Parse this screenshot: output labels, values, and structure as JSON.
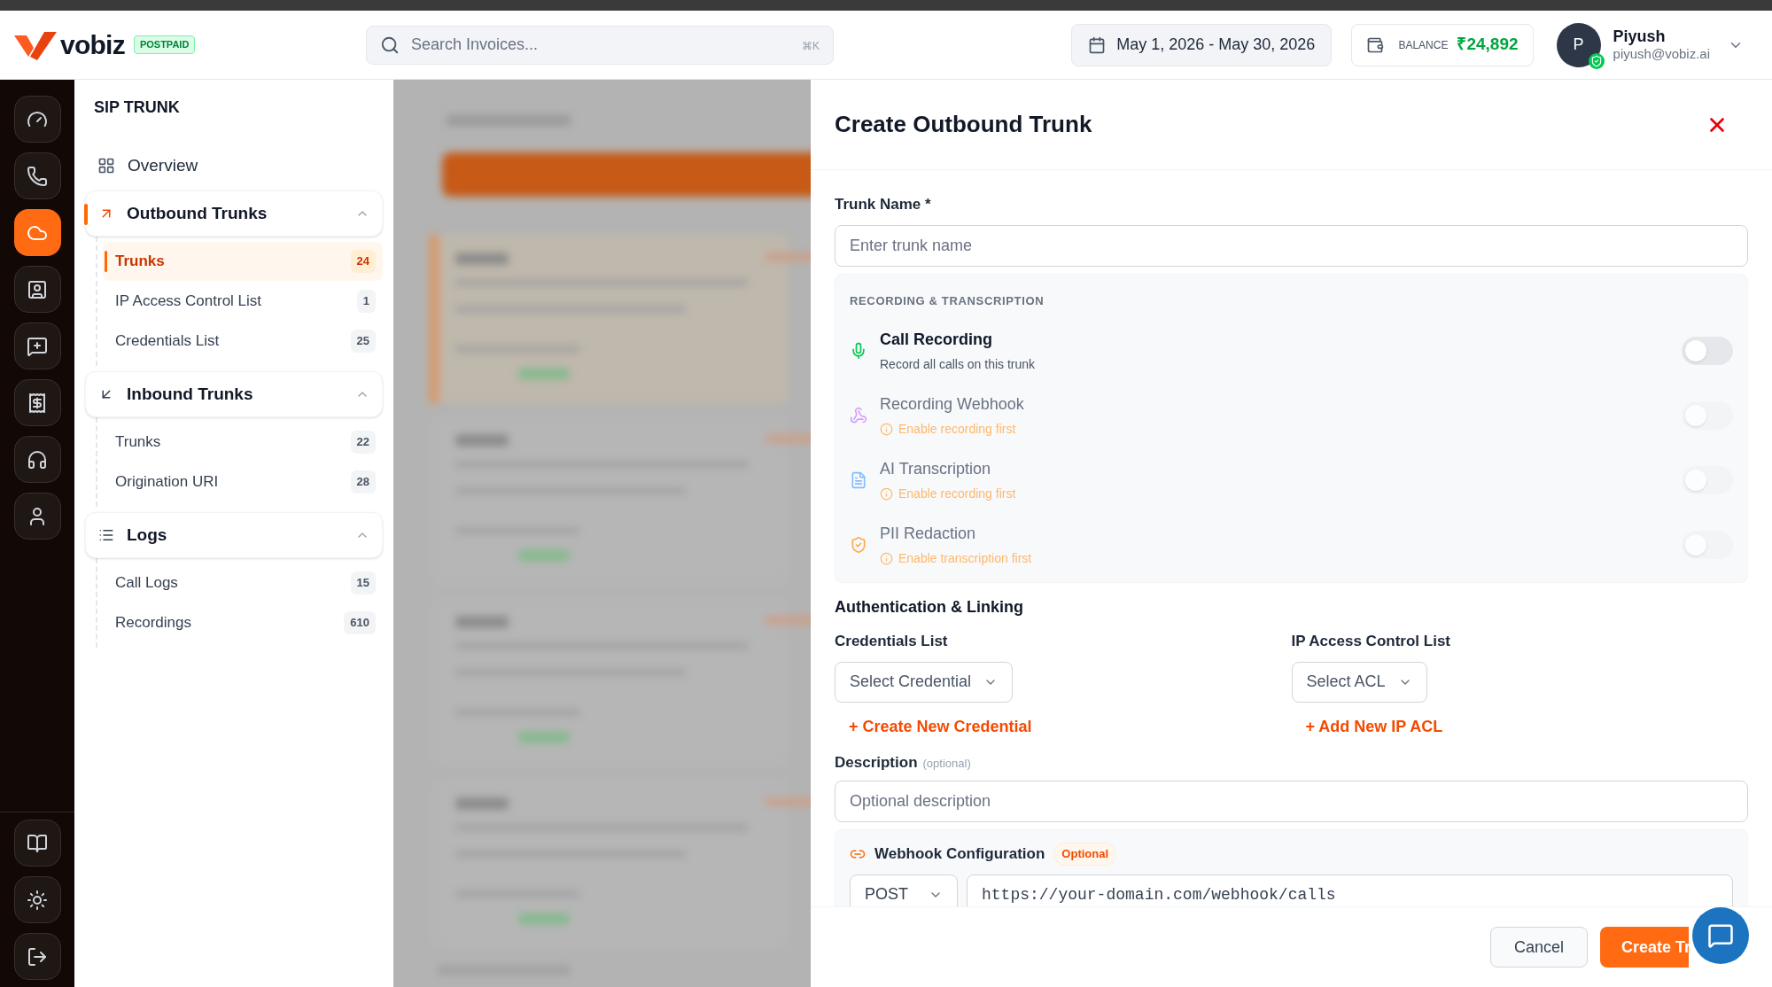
{
  "top_bar": {
    "logo": "vobiz",
    "plan_badge": "POSTPAID",
    "search": {
      "placeholder": "Search Invoices...",
      "shortcut": "⌘K"
    },
    "date_range": "May 1, 2026 - May 30, 2026",
    "balance": {
      "label": "BALANCE",
      "value": "₹24,892"
    },
    "user": {
      "initial": "P",
      "name": "Piyush",
      "email": "piyush@vobiz.ai"
    }
  },
  "rail": {
    "items": [
      {
        "selected": false
      },
      {
        "selected": false
      },
      {
        "selected": true
      },
      {
        "selected": false
      },
      {
        "selected": false
      },
      {
        "selected": false
      },
      {
        "selected": false
      },
      {
        "selected": false
      }
    ],
    "bottom_items": [
      {
        "selected": false
      },
      {
        "selected": false
      },
      {
        "selected": false
      }
    ]
  },
  "nav": {
    "title": "SIP TRUNK",
    "overview": "Overview",
    "groups": [
      {
        "label": "Outbound Trunks",
        "expanded": true,
        "selected": true,
        "items": [
          {
            "label": "Trunks",
            "count": "24",
            "selected": true
          },
          {
            "label": "IP Access Control List",
            "count": "1",
            "selected": false
          },
          {
            "label": "Credentials List",
            "count": "25",
            "selected": false
          }
        ]
      },
      {
        "label": "Inbound Trunks",
        "expanded": true,
        "selected": false,
        "items": [
          {
            "label": "Trunks",
            "count": "22",
            "selected": false
          },
          {
            "label": "Origination URI",
            "count": "28",
            "selected": false
          }
        ]
      },
      {
        "label": "Logs",
        "expanded": true,
        "selected": false,
        "items": [
          {
            "label": "Call Logs",
            "count": "15",
            "selected": false
          },
          {
            "label": "Recordings",
            "count": "610",
            "selected": false
          }
        ]
      }
    ]
  },
  "drawer": {
    "title": "Create Outbound Trunk",
    "trunk_name": {
      "label": "Trunk Name *",
      "placeholder": "Enter trunk name"
    },
    "recording": {
      "title": "RECORDING & TRANSCRIPTION",
      "options": [
        {
          "label": "Call Recording",
          "note": "Record all calls on this trunk",
          "disabled": false,
          "on": false
        },
        {
          "label": "Recording Webhook",
          "note": "Enable recording first",
          "disabled": true,
          "on": false
        },
        {
          "label": "AI Transcription",
          "note": "Enable recording first",
          "disabled": true,
          "on": false
        },
        {
          "label": "PII Redaction",
          "note": "Enable transcription first",
          "disabled": true,
          "on": false
        }
      ]
    },
    "auth": {
      "heading": "Authentication & Linking",
      "credentials": {
        "label": "Credentials List",
        "placeholder": "Select Credential",
        "link": "+ Create New Credential"
      },
      "acl": {
        "label": "IP Access Control List",
        "placeholder": "Select ACL",
        "link": "+ Add New IP ACL"
      }
    },
    "description": {
      "label": "Description",
      "optional": "(optional)",
      "placeholder": "Optional description"
    },
    "webhook": {
      "title": "Webhook Configuration",
      "badge": "Optional",
      "method": "POST",
      "url": "https://your-domain.com/webhook/calls"
    },
    "buttons": {
      "cancel": "Cancel",
      "create": "Create Tr"
    }
  }
}
